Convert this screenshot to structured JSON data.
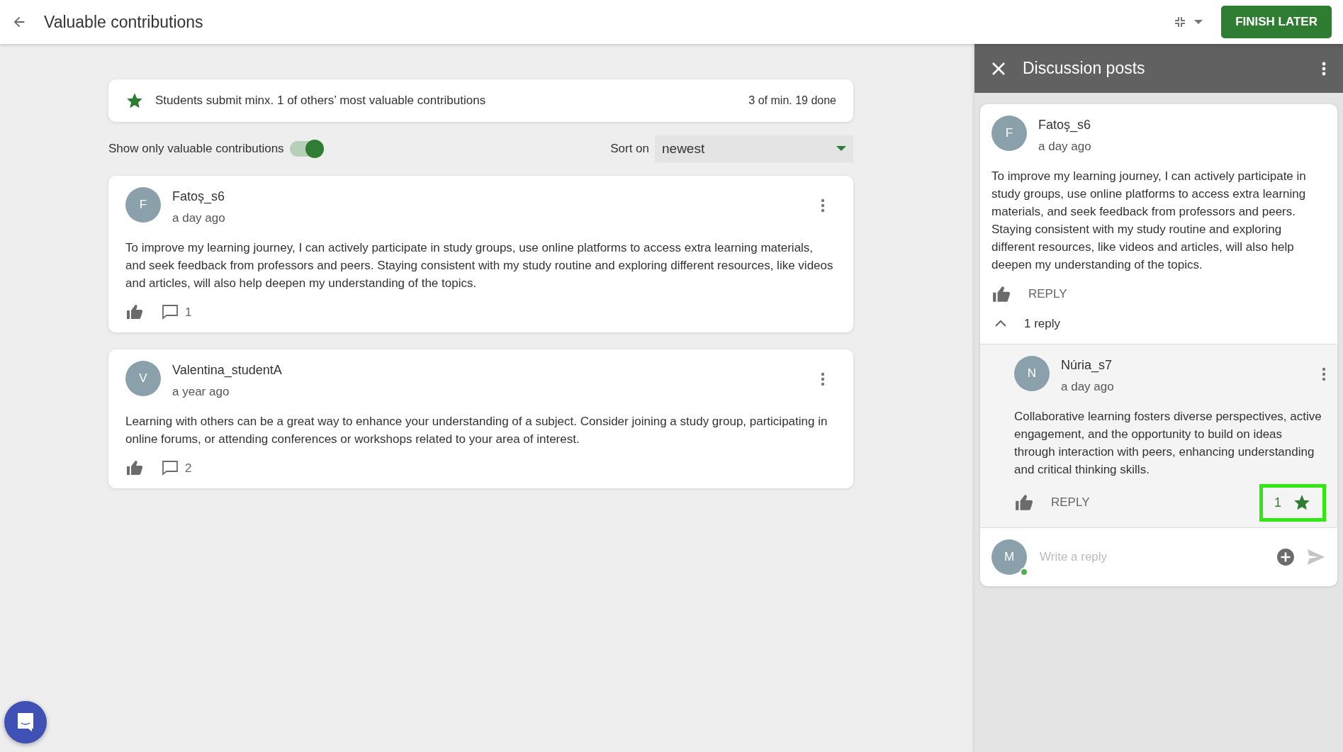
{
  "header": {
    "title": "Valuable contributions",
    "finish_button": "FINISH LATER"
  },
  "summary": {
    "text": "Students submit minx. 1 of others’ most valuable contributions",
    "progress": "3 of min. 19 done"
  },
  "filter": {
    "label": "Show only valuable contributions",
    "on": true
  },
  "sort": {
    "label": "Sort on",
    "value": "newest"
  },
  "posts": [
    {
      "initial": "F",
      "author": "Fatoş_s6",
      "time": "a day ago",
      "body": "To improve my learning journey, I can actively participate in study groups, use online platforms to access extra learning materials, and seek feedback from professors and peers. Staying consistent with my study routine and exploring different resources, like videos and articles, will also help deepen my understanding of the topics.",
      "comments": "1"
    },
    {
      "initial": "V",
      "author": "Valentina_studentA",
      "time": "a year ago",
      "body": "Learning with others can be a great way to enhance your understanding of a subject. Consider joining a study group, participating in online forums, or attending conferences or workshops related to your area of interest.",
      "comments": "2"
    }
  ],
  "panel": {
    "title": "Discussion posts",
    "post": {
      "initial": "F",
      "author": "Fatoş_s6",
      "time": "a day ago",
      "body": "To improve my learning journey, I can actively participate in study groups, use online platforms to access extra learning materials, and seek feedback from professors and peers. Staying consistent with my study routine and exploring different resources, like videos and articles, will also help deepen my understanding of the topics.",
      "reply_label": "REPLY",
      "replies_label": "1 reply",
      "expanded": true,
      "replies": [
        {
          "initial": "N",
          "author": "Núria_s7",
          "time": "a day ago",
          "body": "Collaborative learning fosters diverse perspectives, active engagement, and the opportunity to build on ideas through interaction with peers, enhancing understanding and critical thinking skills.",
          "reply_label": "REPLY",
          "valuable_count": "1",
          "highlighted": true
        }
      ]
    },
    "composer": {
      "initial": "M",
      "placeholder": "Write a reply",
      "online": true
    }
  }
}
